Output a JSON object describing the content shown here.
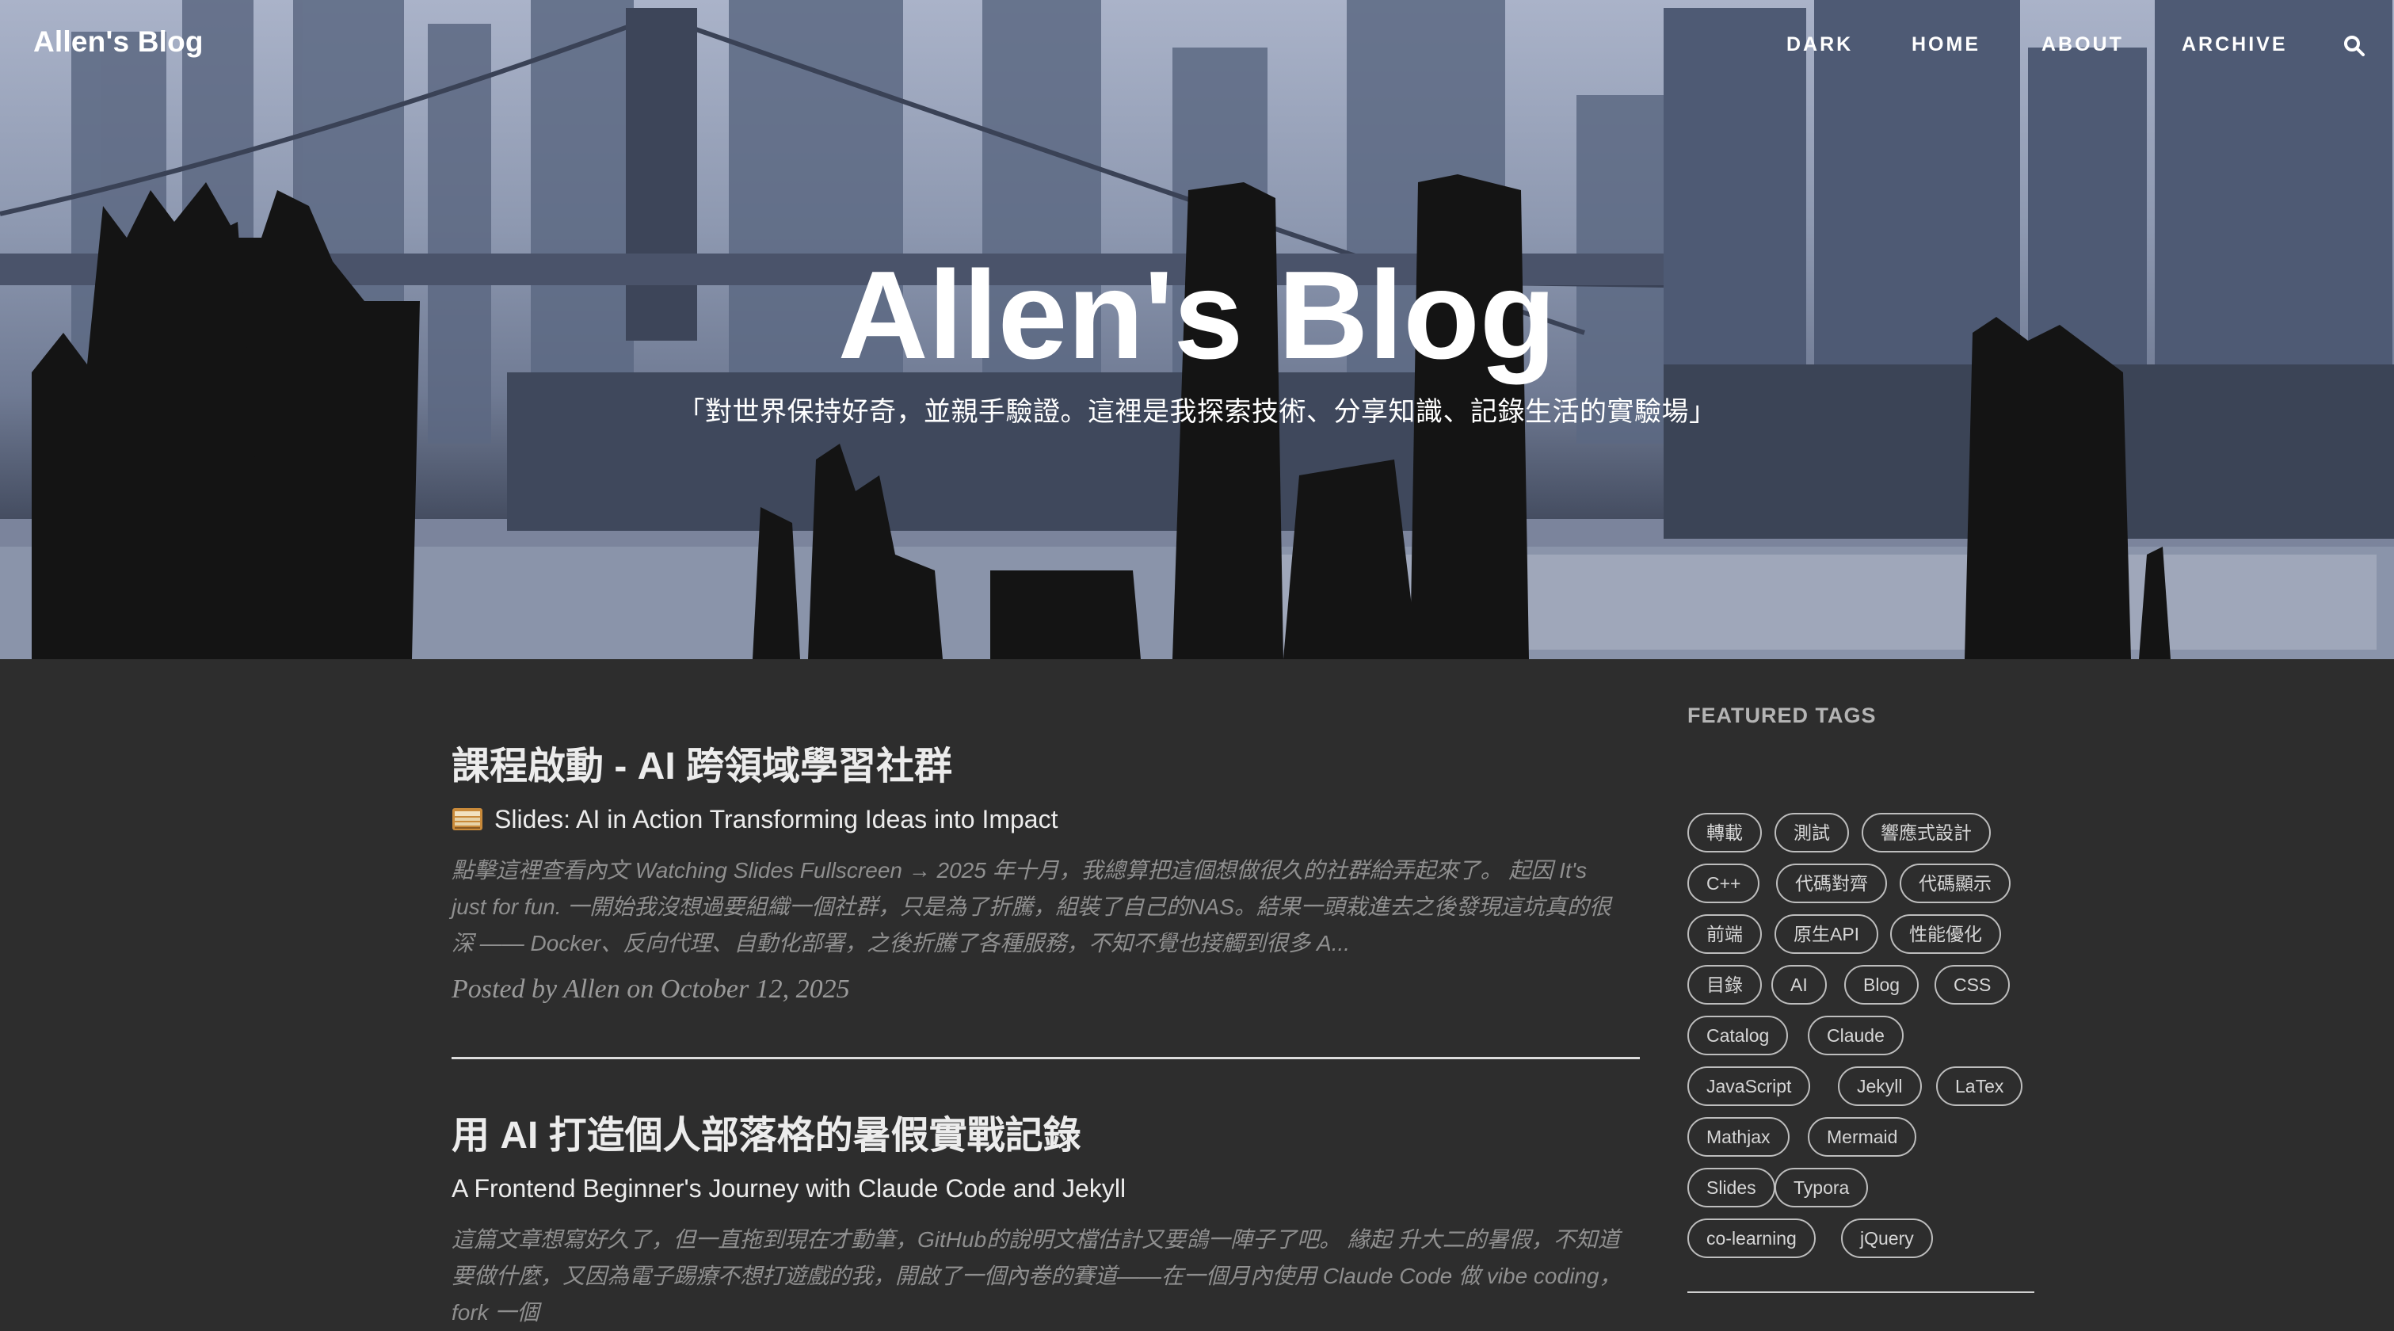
{
  "nav": {
    "brand": "Allen's Blog",
    "items": [
      "DARK",
      "HOME",
      "ABOUT",
      "ARCHIVE"
    ]
  },
  "hero": {
    "title": "Allen's Blog",
    "subtitle": "「對世界保持好奇，並親手驗證。這裡是我探索技術、分享知識、記錄生活的實驗場」"
  },
  "posts": [
    {
      "title": "課程啟動 - AI 跨領域學習社群",
      "subtitle": "Slides: AI in Action Transforming Ideas into Impact",
      "subtitle_icon": "slides-icon",
      "excerpt": "點擊這裡查看內文 Watching Slides Fullscreen → 2025 年十月，我總算把這個想做很久的社群給弄起來了。 起因 It's just for fun. 一開始我沒想過要組織一個社群，只是為了折騰，組裝了自己的NAS。結果一頭栽進去之後發現這坑真的很深 —— Docker、反向代理、自動化部署，之後折騰了各種服務，不知不覺也接觸到很多 A...",
      "meta": "Posted by Allen on October 12, 2025"
    },
    {
      "title": "用 AI 打造個人部落格的暑假實戰記錄",
      "subtitle": "A Frontend Beginner's Journey with Claude Code and Jekyll",
      "excerpt": "這篇文章想寫好久了，但一直拖到現在才動筆，GitHub的說明文檔估計又要鴿一陣子了吧。 緣起 升大二的暑假，不知道要做什麼，又因為電子踢療不想打遊戲的我，開啟了一個內卷的賽道——在一個月內使用 Claude Code 做 vibe coding，fork 一個"
    }
  ],
  "sidebar": {
    "heading": "FEATURED TAGS",
    "tags": [
      "轉載",
      "測試",
      "響應式設計",
      "C++",
      "代碼對齊",
      "代碼顯示",
      "前端",
      "原生API",
      "性能優化",
      "目錄",
      "AI",
      "Blog",
      "CSS",
      "Catalog",
      "Claude",
      "JavaScript",
      "Jekyll",
      "LaTex",
      "Mathjax",
      "Mermaid",
      "Slides",
      "Typora",
      "co-learning",
      "jQuery"
    ]
  }
}
